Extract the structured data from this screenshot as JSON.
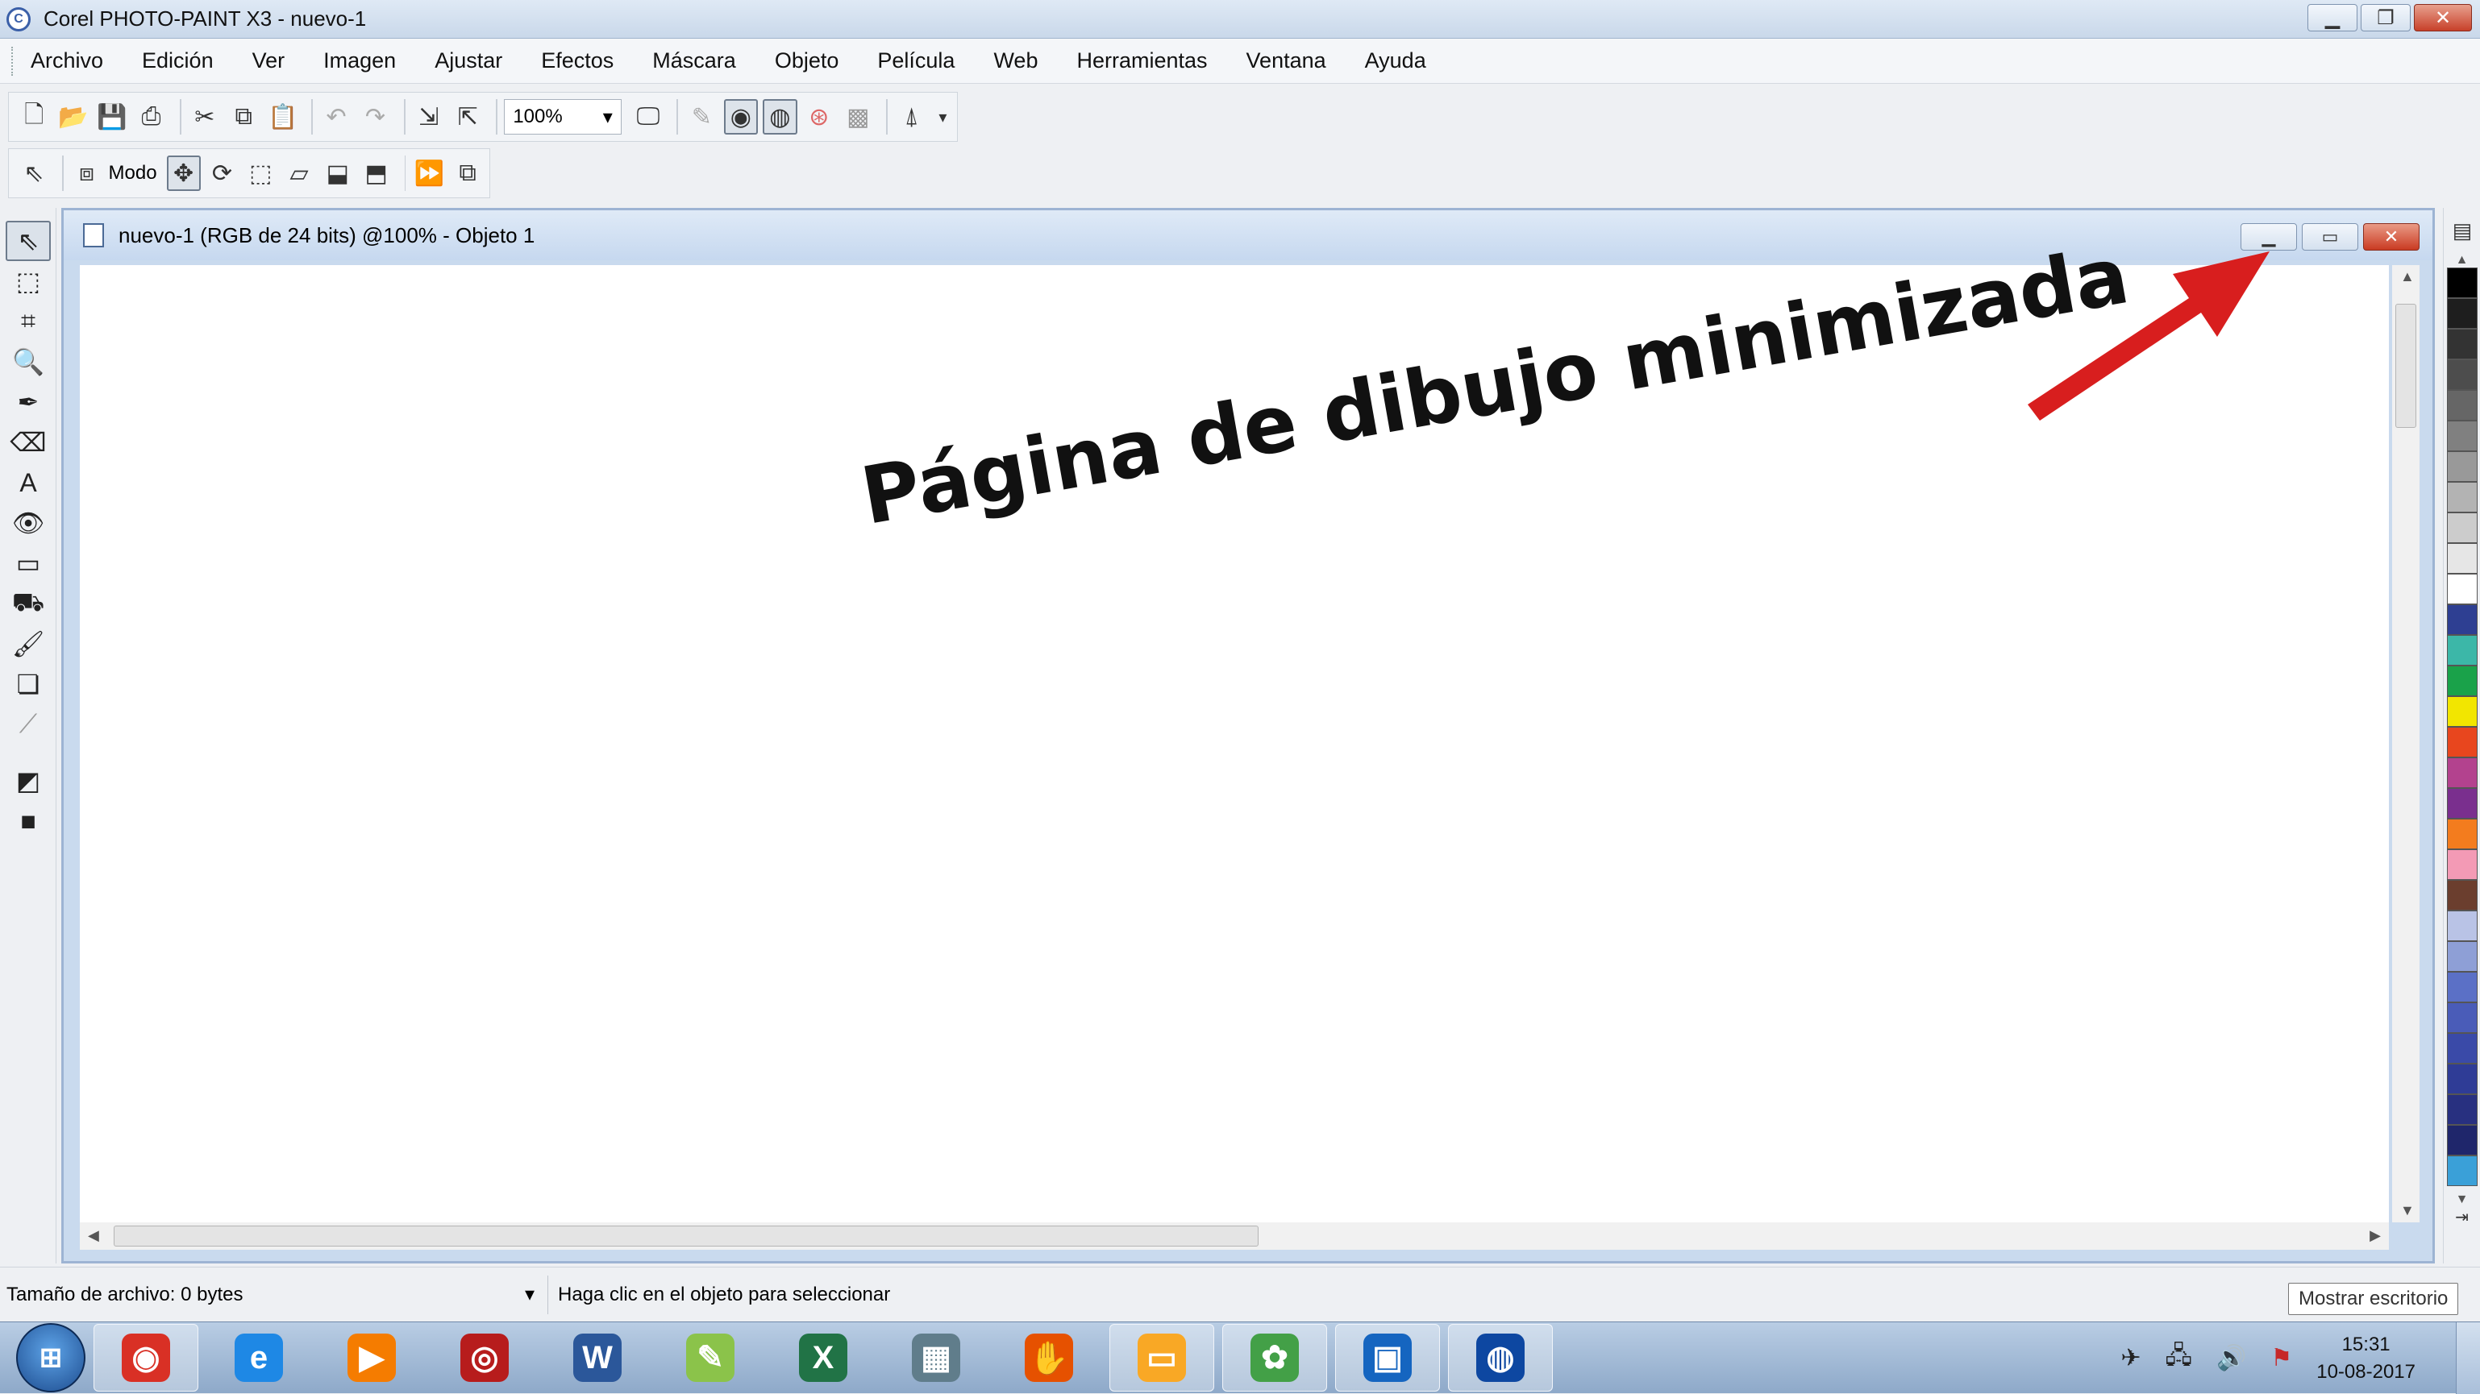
{
  "app": {
    "title": "Corel PHOTO-PAINT X3 - nuevo-1",
    "icon": "corel-app-icon"
  },
  "menu": [
    {
      "label": "Archivo"
    },
    {
      "label": "Edición"
    },
    {
      "label": "Ver"
    },
    {
      "label": "Imagen"
    },
    {
      "label": "Ajustar"
    },
    {
      "label": "Efectos"
    },
    {
      "label": "Máscara"
    },
    {
      "label": "Objeto"
    },
    {
      "label": "Película"
    },
    {
      "label": "Web"
    },
    {
      "label": "Herramientas"
    },
    {
      "label": "Ventana"
    },
    {
      "label": "Ayuda"
    }
  ],
  "toolbar": {
    "zoom_value": "100%",
    "modo_label": "Modo"
  },
  "document": {
    "title": "nuevo-1 (RGB de 24 bits) @100% - Objeto 1"
  },
  "annotation": {
    "text": "Página de dibujo minimizada"
  },
  "status": {
    "file_size": "Tamaño de archivo: 0 bytes",
    "message": "Haga clic en el objeto para seleccionar"
  },
  "tooltip": {
    "text": "Mostrar escritorio"
  },
  "clock": {
    "time": "15:31",
    "date": "10-08-2017"
  },
  "palette": [
    "#000000",
    "#1e1e1e",
    "#333333",
    "#4d4d4d",
    "#666666",
    "#808080",
    "#999999",
    "#b3b3b3",
    "#cccccc",
    "#e6e6e6",
    "#ffffff",
    "#2e3f92",
    "#3cb7a8",
    "#1aa24a",
    "#f2e600",
    "#e8461e",
    "#b3428e",
    "#7a2f8e",
    "#f37c1e",
    "#f39ab5",
    "#6b3e2e",
    "#b9c3e6",
    "#8e9fd6",
    "#5b70c6",
    "#4a5cb8",
    "#3a4aa8",
    "#2f3c96",
    "#283080",
    "#1f266b",
    "#3aa0d8"
  ],
  "colors": {
    "accent_arrow": "#d81e1e",
    "titlebar": "#c9d8ea"
  },
  "taskbar_apps": [
    {
      "name": "chrome-icon",
      "glyph": "◉",
      "color": "#d93025"
    },
    {
      "name": "internet-explorer-icon",
      "glyph": "e",
      "color": "#1e88e5"
    },
    {
      "name": "media-player-icon",
      "glyph": "▶",
      "color": "#f57c00"
    },
    {
      "name": "corel-draw-icon",
      "glyph": "◎",
      "color": "#b71c1c"
    },
    {
      "name": "word-icon",
      "glyph": "W",
      "color": "#2b579a"
    },
    {
      "name": "paint-icon",
      "glyph": "✎",
      "color": "#8bc34a"
    },
    {
      "name": "excel-icon",
      "glyph": "X",
      "color": "#217346"
    },
    {
      "name": "calculator-icon",
      "glyph": "▦",
      "color": "#607d8b"
    },
    {
      "name": "glove-app-icon",
      "glyph": "✋",
      "color": "#e65100"
    },
    {
      "name": "file-explorer-icon",
      "glyph": "▭",
      "color": "#f9a825"
    },
    {
      "name": "corel-capture-icon",
      "glyph": "✿",
      "color": "#43a047"
    },
    {
      "name": "picture-viewer-icon",
      "glyph": "▣",
      "color": "#1565c0"
    },
    {
      "name": "corel-photo-paint-icon",
      "glyph": "◍",
      "color": "#0d47a1"
    }
  ]
}
